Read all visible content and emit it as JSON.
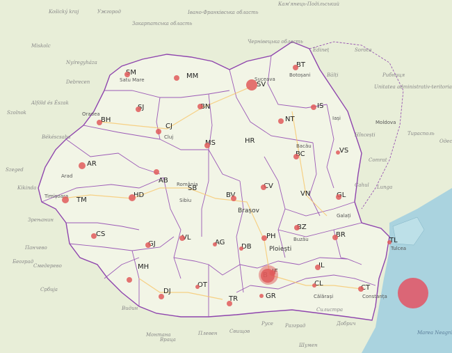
{
  "map": {
    "county_codes": [
      "SM",
      "MM",
      "BT",
      "SV",
      "BH",
      "SJ",
      "BN",
      "IS",
      "CJ",
      "NT",
      "MS",
      "HR",
      "VS",
      "AR",
      "BC",
      "AB",
      "SB",
      "BV",
      "CV",
      "VN",
      "GL",
      "TM",
      "HD",
      "CS",
      "VL",
      "GJ",
      "AG",
      "PH",
      "BZ",
      "BR",
      "TL",
      "DB",
      "IF",
      "B",
      "CL",
      "IL",
      "CT",
      "GR",
      "TR",
      "OT",
      "DJ",
      "MH"
    ],
    "county_labels": [
      {
        "code": "SM"
      },
      {
        "code": "MM"
      },
      {
        "code": "BT"
      },
      {
        "code": "SV"
      },
      {
        "code": "BH"
      },
      {
        "code": "SJ"
      },
      {
        "code": "BN"
      },
      {
        "code": "IS"
      },
      {
        "code": "CJ"
      },
      {
        "code": "NT"
      },
      {
        "code": "MS"
      },
      {
        "code": "HR"
      },
      {
        "code": "VS"
      },
      {
        "code": "AR"
      },
      {
        "code": "BC"
      },
      {
        "code": "AB"
      },
      {
        "code": "SB"
      },
      {
        "code": "BV"
      },
      {
        "code": "CV"
      },
      {
        "code": "VN"
      },
      {
        "code": "GL"
      },
      {
        "code": "TM"
      },
      {
        "code": "HD"
      },
      {
        "code": "CS"
      },
      {
        "code": "VL"
      },
      {
        "code": "GJ"
      },
      {
        "code": "AG"
      },
      {
        "code": "PH"
      },
      {
        "code": "BZ"
      },
      {
        "code": "BR"
      },
      {
        "code": "TL"
      },
      {
        "code": "DB"
      },
      {
        "code": "IF"
      },
      {
        "code": "B"
      },
      {
        "code": "CL"
      },
      {
        "code": "IL"
      },
      {
        "code": "CT"
      },
      {
        "code": "GR"
      },
      {
        "code": "TR"
      },
      {
        "code": "OT"
      },
      {
        "code": "DJ"
      },
      {
        "code": "MH"
      }
    ],
    "cities": [
      "Timișoara",
      "Brașov",
      "Ploiești",
      "Iași",
      "Galați",
      "România",
      "Moldova",
      "Tulcea",
      "Arad",
      "Bacău",
      "Suceava",
      "Botoșani",
      "Cluj",
      "Sibiu",
      "Buzău",
      "Călărași",
      "Constanța",
      "Satu Mare",
      "Oradea"
    ],
    "neighbor_labels": [
      "Košický kraj",
      "Ужгород",
      "Івано-Франківська область",
      "Закарпатська область",
      "Чернівецька область",
      "Кам'янець-Подільський",
      "Edineț",
      "Soroca",
      "Рибниця",
      "Unitatea administrativ-teritorială din stânga Nistrului",
      "Hîncești",
      "Тирасполь",
      "Одеса",
      "Szolnok",
      "Debrecen",
      "Nyíregyháza",
      "Miskolc",
      "Alföld és Észak",
      "Békéscsaba",
      "Szeged",
      "Kikinda",
      "Зрењанин",
      "Панчево",
      "Београд",
      "Смедерево",
      "Србија",
      "Видин",
      "Монтана",
      "Враца",
      "Плевен",
      "Свищов",
      "Русе",
      "Разград",
      "Шумен",
      "Добрич",
      "Силистра",
      "Cahul",
      "Comrat",
      "Bălți",
      "Lunga"
    ],
    "sea_label": "Marea Neagră",
    "markers": [
      {
        "code": "SV",
        "value": 18
      },
      {
        "code": "B",
        "value": 22
      },
      {
        "code": "offshore",
        "value": 34
      }
    ],
    "colors": {
      "land": "#eef2df",
      "romania_fill": "#f4f6e8",
      "water": "#aad3df",
      "county_border": "#9b59b6",
      "marker": "#e05a5a",
      "road": "#f7c76b",
      "forest": "#cfe3b3"
    }
  }
}
